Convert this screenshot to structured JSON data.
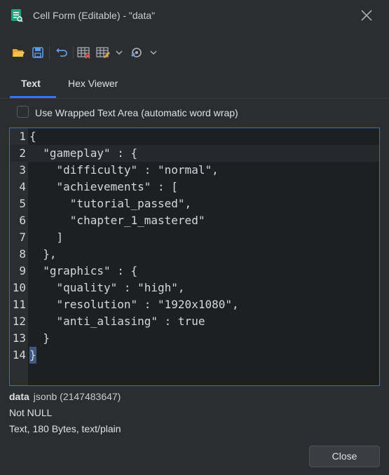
{
  "window": {
    "title": "Cell Form (Editable) - \"data\"",
    "app_icon": "datagrip-form-icon",
    "close_icon": "close-icon"
  },
  "toolbar": {
    "buttons": [
      "open-folder-icon",
      "save-icon",
      "revert-icon",
      "grid-delete-icon",
      "grid-edit-icon",
      "chevron-down-icon",
      "tools-icon",
      "chevron-down-icon"
    ]
  },
  "tabs": [
    {
      "label": "Text",
      "active": true
    },
    {
      "label": "Hex Viewer",
      "active": false
    }
  ],
  "wrap_option": {
    "label": "Use Wrapped Text Area (automatic word wrap)",
    "checked": false
  },
  "editor": {
    "lines": [
      {
        "num": "1",
        "text": "{"
      },
      {
        "num": "2",
        "text": "  \"gameplay\" : {"
      },
      {
        "num": "3",
        "text": "    \"difficulty\" : \"normal\","
      },
      {
        "num": "4",
        "text": "    \"achievements\" : ["
      },
      {
        "num": "5",
        "text": "      \"tutorial_passed\","
      },
      {
        "num": "6",
        "text": "      \"chapter_1_mastered\""
      },
      {
        "num": "7",
        "text": "    ]"
      },
      {
        "num": "8",
        "text": "  },"
      },
      {
        "num": "9",
        "text": "  \"graphics\" : {"
      },
      {
        "num": "10",
        "text": "    \"quality\" : \"high\","
      },
      {
        "num": "11",
        "text": "    \"resolution\" : \"1920x1080\","
      },
      {
        "num": "12",
        "text": "    \"anti_aliasing\" : true"
      },
      {
        "num": "13",
        "text": "  }"
      },
      {
        "num": "14",
        "text": "}"
      }
    ]
  },
  "column_info": {
    "name": "data",
    "type": "jsonb (2147483647)",
    "nullability": "Not NULL",
    "details": "Text, 180 Bytes, text/plain"
  },
  "buttons": {
    "close": "Close"
  },
  "colors": {
    "accent": "#3574f0",
    "background": "#2b2d30",
    "editor_bg": "#1e1f22"
  }
}
